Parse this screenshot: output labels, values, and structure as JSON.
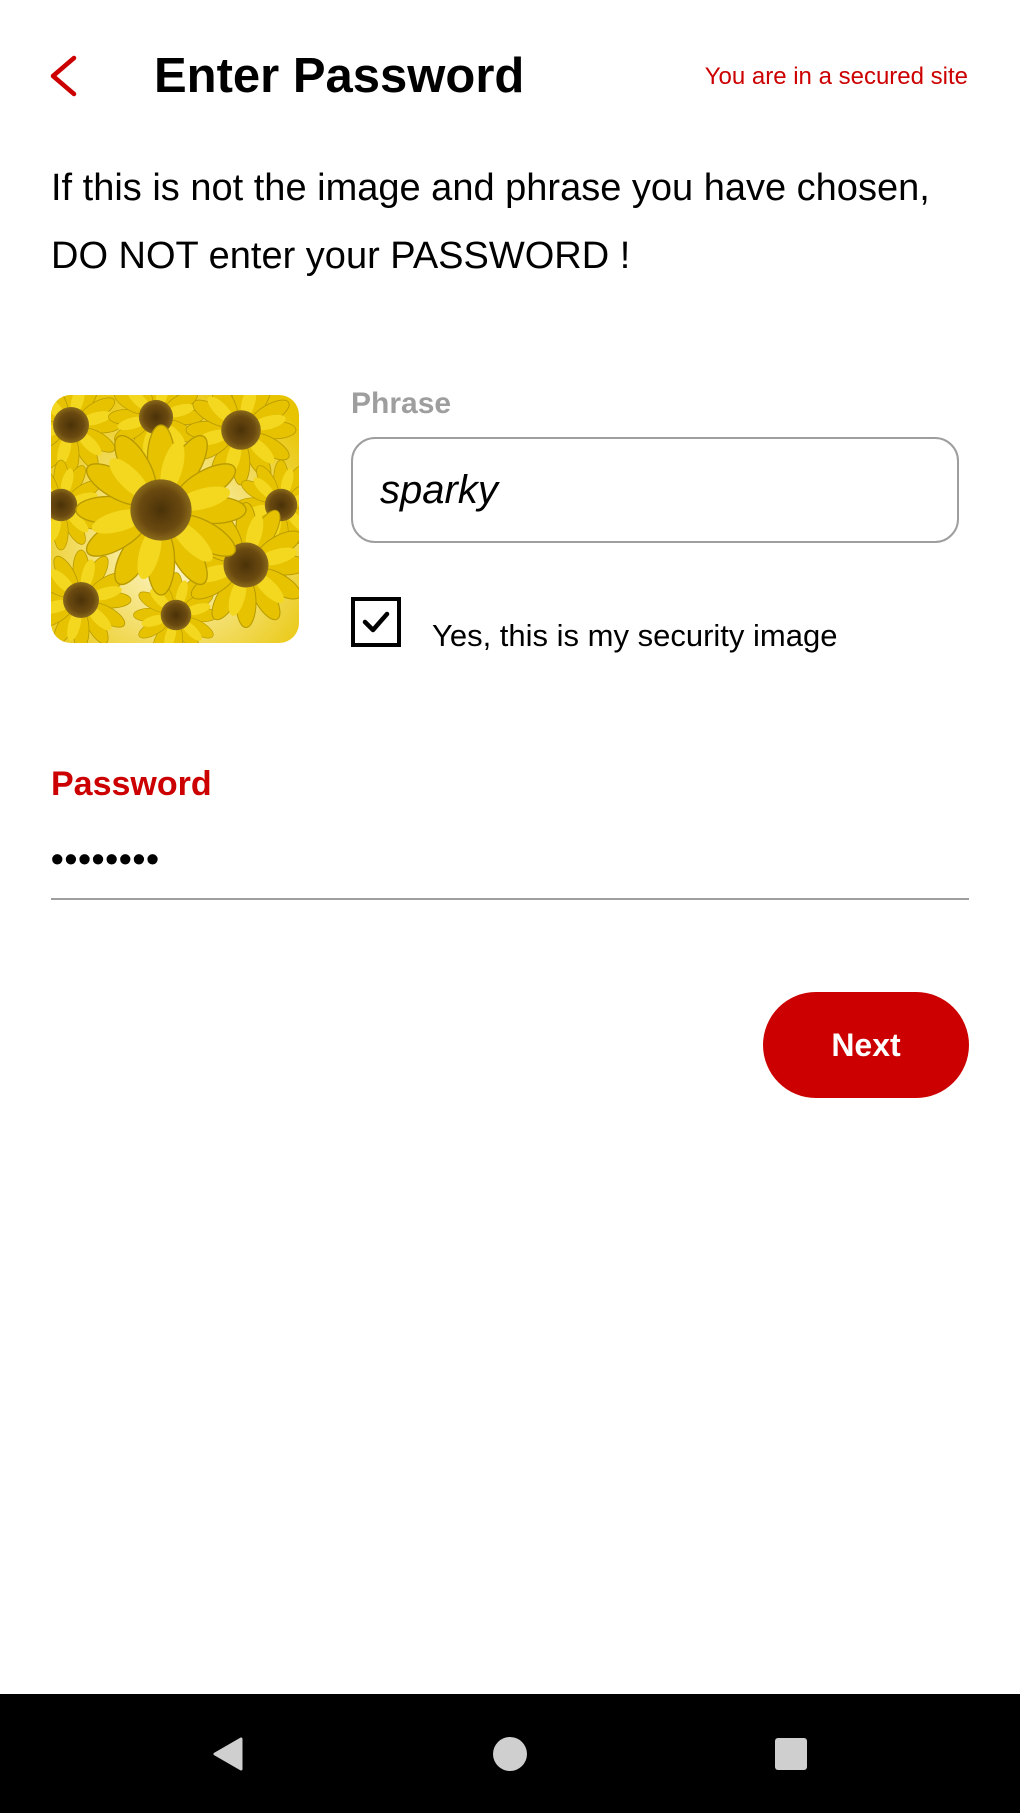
{
  "header": {
    "title": "Enter Password",
    "secure_note": "You are in a secured site",
    "back_icon": "chevron-left-icon"
  },
  "warning": {
    "text": "If this is not the image and phrase you have chosen, DO NOT enter your PASSWORD !"
  },
  "security": {
    "image_icon": "sunflower-image",
    "phrase_label": "Phrase",
    "phrase_value": "sparky",
    "checkbox_checked": true,
    "checkbox_label": "Yes, this is my security image"
  },
  "password": {
    "label": "Password",
    "masked_value": "••••••••"
  },
  "actions": {
    "next_label": "Next"
  },
  "nav": {
    "back_icon": "triangle-back-icon",
    "home_icon": "circle-home-icon",
    "recents_icon": "square-recents-icon"
  },
  "colors": {
    "accent": "#cc0000",
    "muted": "#9e9e9e",
    "nav_bar": "#000000",
    "nav_icon": "#cfcfcf"
  }
}
